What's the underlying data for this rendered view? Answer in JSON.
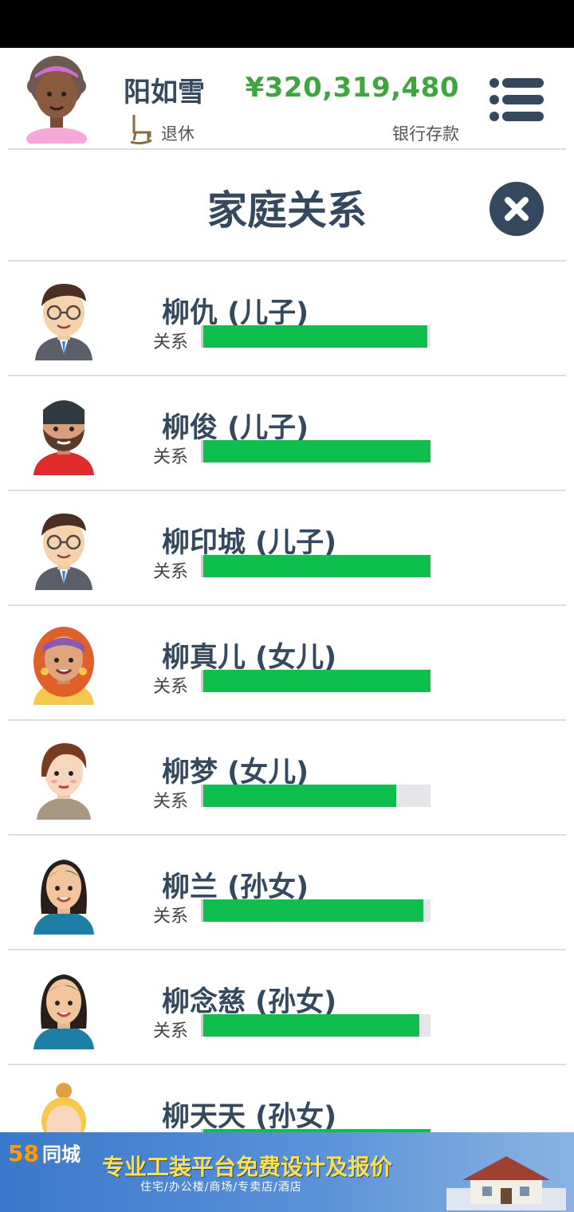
{
  "header": {
    "name": "阳如雪",
    "status": "退休",
    "money": "¥320,319,480",
    "money_label": "银行存款"
  },
  "page": {
    "title": "家庭关系"
  },
  "relation_label": "关系",
  "members": [
    {
      "name": "柳仇 (儿子)",
      "relationship": 0.985,
      "avatar": "man-glasses-suit"
    },
    {
      "name": "柳俊 (儿子)",
      "relationship": 1.0,
      "avatar": "man-beard-beanie"
    },
    {
      "name": "柳印城 (儿子)",
      "relationship": 1.0,
      "avatar": "man-glasses-suit"
    },
    {
      "name": "柳真儿 (女儿)",
      "relationship": 1.0,
      "avatar": "woman-red-hair-headband"
    },
    {
      "name": "柳梦 (女儿)",
      "relationship": 0.85,
      "avatar": "woman-brown-hair"
    },
    {
      "name": "柳兰 (孙女)",
      "relationship": 0.97,
      "avatar": "woman-black-hair"
    },
    {
      "name": "柳念慈 (孙女)",
      "relationship": 0.95,
      "avatar": "woman-black-hair"
    },
    {
      "name": "柳天天 (孙女)",
      "relationship": 1.0,
      "avatar": "girl-blonde-bun"
    }
  ],
  "ad": {
    "logo_num": "58",
    "logo_text": "同城",
    "headline": "专业工装平台免费设计及报价",
    "subline": "住宅/办公楼/商场/专卖店/酒店"
  },
  "colors": {
    "bar_fill": "#0fbf4d",
    "bar_track": "#e6e6ea",
    "money": "#3fa63f",
    "text": "#34495e",
    "ad_bg": "#3a78c9"
  }
}
